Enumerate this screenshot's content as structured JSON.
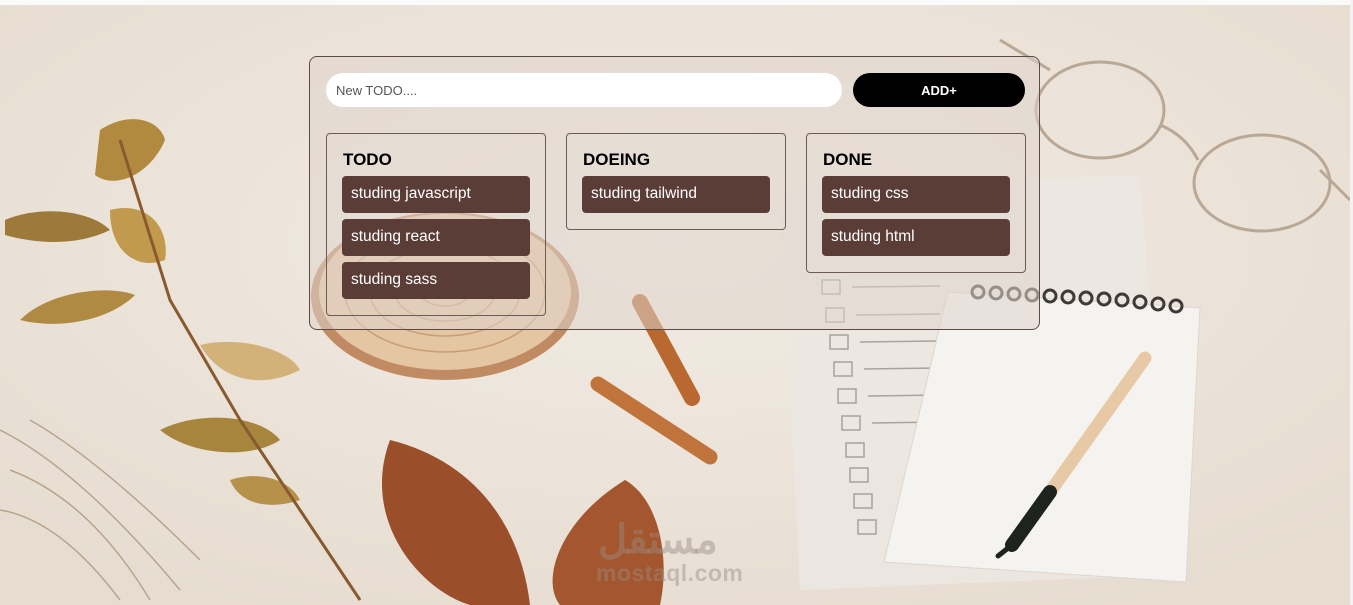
{
  "form": {
    "input_placeholder": "New TODO....",
    "input_value": "",
    "add_label": "ADD+"
  },
  "columns": [
    {
      "title": "TODO",
      "tasks": [
        "studing javascript",
        "studing react",
        "studing sass"
      ]
    },
    {
      "title": "DOEING",
      "tasks": [
        "studing tailwind"
      ]
    },
    {
      "title": "DONE",
      "tasks": [
        "studing css",
        "studing html"
      ]
    }
  ],
  "watermark": {
    "arabic": "مستقل",
    "latin": "mostaql.com"
  },
  "colors": {
    "task_bg": "#5b3d38",
    "add_button_bg": "#000000",
    "panel_border": "#5c4a44"
  }
}
